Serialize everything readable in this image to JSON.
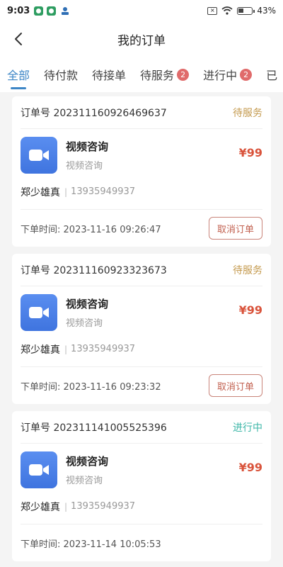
{
  "status_bar": {
    "time": "9:03",
    "battery": "43%"
  },
  "nav": {
    "title": "我的订单"
  },
  "tabs": [
    {
      "label": "全部",
      "active": true,
      "badge": null
    },
    {
      "label": "待付款",
      "active": false,
      "badge": null
    },
    {
      "label": "待接单",
      "active": false,
      "badge": null
    },
    {
      "label": "待服务",
      "active": false,
      "badge": "2"
    },
    {
      "label": "进行中",
      "active": false,
      "badge": "2"
    },
    {
      "label": "已",
      "active": false,
      "badge": null
    }
  ],
  "orders": [
    {
      "order_prefix": "订单号",
      "order_no": "202311160926469637",
      "status": "待服务",
      "status_color": "#c49a4e",
      "title": "视频咨询",
      "subtitle": "视频咨询",
      "price": "¥99",
      "buyer": "郑少雄真",
      "divider": "|",
      "phone": "13935949937",
      "time_label": "下单时间:",
      "time": "2023-11-16 09:26:47",
      "cancel_label": "取消订单"
    },
    {
      "order_prefix": "订单号",
      "order_no": "202311160923323673",
      "status": "待服务",
      "status_color": "#c49a4e",
      "title": "视频咨询",
      "subtitle": "视频咨询",
      "price": "¥99",
      "buyer": "郑少雄真",
      "divider": "|",
      "phone": "13935949937",
      "time_label": "下单时间:",
      "time": "2023-11-16 09:23:32",
      "cancel_label": "取消订单"
    },
    {
      "order_prefix": "订单号",
      "order_no": "202311141005525396",
      "status": "进行中",
      "status_color": "#3db7a8",
      "title": "视频咨询",
      "subtitle": "视频咨询",
      "price": "¥99",
      "buyer": "郑少雄真",
      "divider": "|",
      "phone": "13935949937",
      "time_label": "下单时间:",
      "time": "2023-11-14 10:05:53",
      "cancel_label": null
    }
  ],
  "colors": {
    "accent": "#3d86c6",
    "price": "#d9533b",
    "badge": "#e06b6b"
  },
  "icons": {
    "back": "back-arrow-icon",
    "product": "video-camera-icon"
  }
}
